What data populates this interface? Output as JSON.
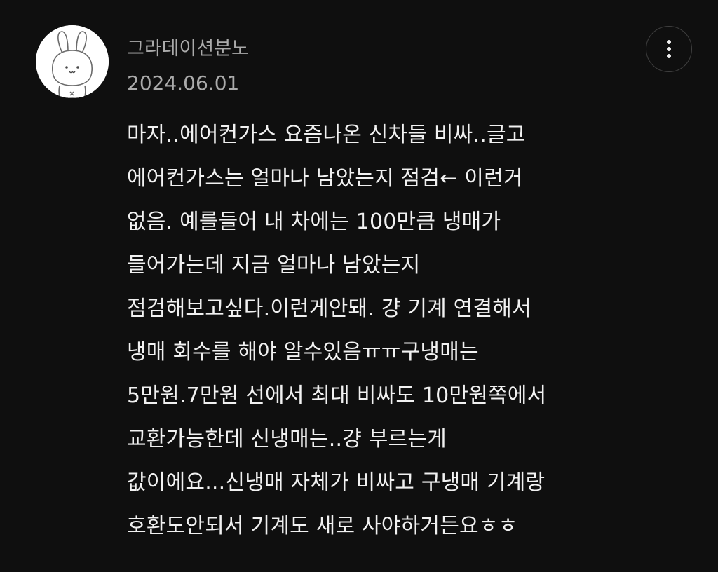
{
  "comment": {
    "author": "그라데이션분노",
    "date": "2024.06.01",
    "avatar_icon": "rabbit-avatar-icon",
    "more_icon": "more-vertical-icon",
    "lines": [
      "마자..에어컨가스 요즘나온 신차들 비싸..글고",
      "에어컨가스는 얼마나 남았는지 점검← 이런거",
      "없음. 예를들어 내 차에는 100만큼 냉매가",
      "들어가는데 지금 얼마나 남았는지",
      "점검해보고싶다.이런게안돼. 걍 기계 연결해서",
      "냉매 회수를 해야 알수있음ㅠㅠ구냉매는",
      "5만원.7만원 선에서 최대 비싸도 10만원쪽에서",
      "교환가능한데 신냉매는..걍 부르는게",
      "값이에요...신냉매 자체가 비싸고 구냉매 기계랑",
      "호환도안되서 기계도 새로 사야하거든요ㅎㅎ"
    ]
  },
  "colors": {
    "background": "#0f0f0f",
    "text_primary": "#f1f1f1",
    "text_secondary": "#aaaaaa"
  }
}
